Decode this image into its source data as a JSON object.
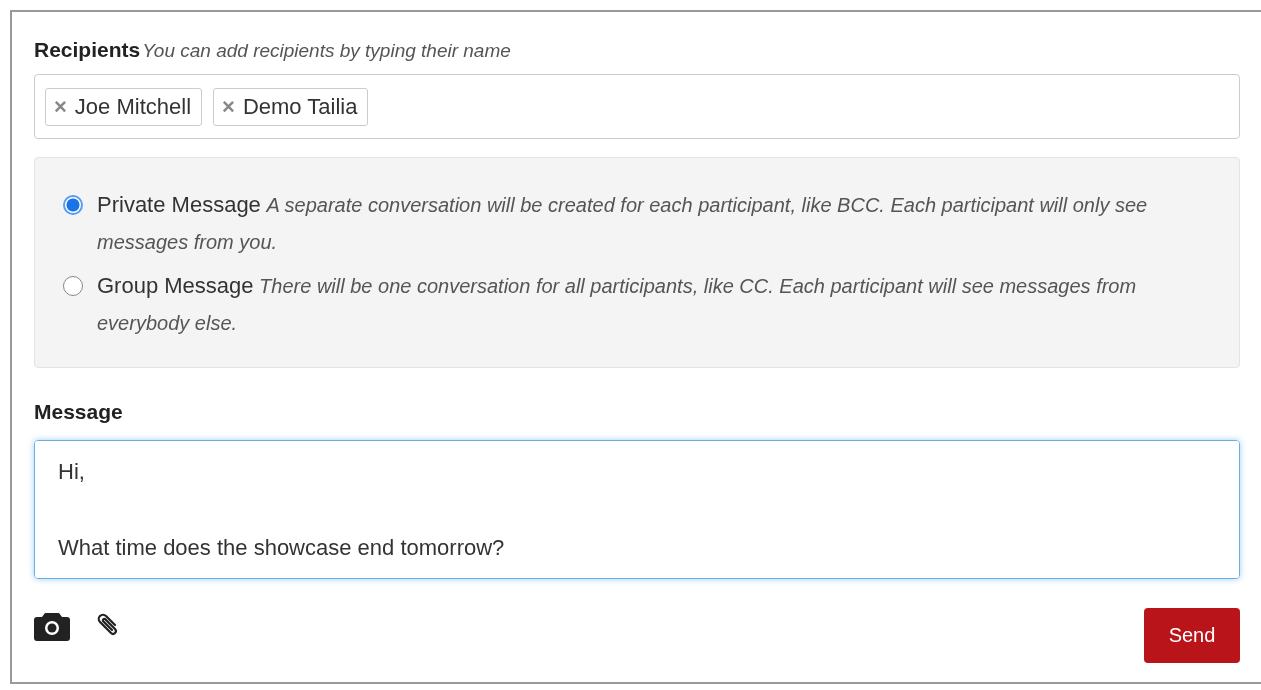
{
  "recipients": {
    "label": "Recipients",
    "hint": "You can add recipients by typing their name",
    "tags": [
      {
        "remove": "×",
        "name": "Joe Mitchell"
      },
      {
        "remove": "×",
        "name": "Demo Tailia"
      }
    ]
  },
  "message_types": [
    {
      "label": "Private Message",
      "description": "A separate conversation will be created for each participant, like BCC. Each participant will only see messages from you.",
      "selected": true
    },
    {
      "label": "Group Message",
      "description": "There will be one conversation for all participants, like CC. Each participant will see messages from everybody else.",
      "selected": false
    }
  ],
  "message": {
    "label": "Message",
    "value": "Hi,\n\nWhat time does the showcase end tomorrow?",
    "focused": true
  },
  "send_button": "Send"
}
